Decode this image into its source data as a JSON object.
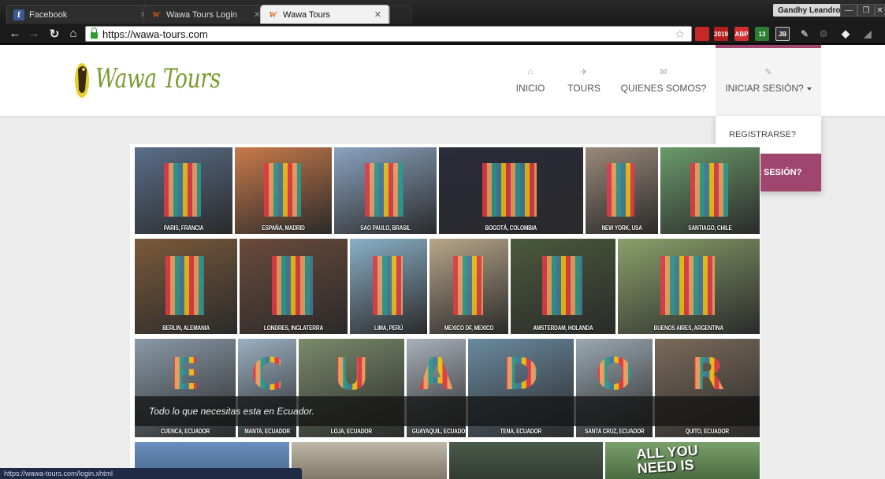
{
  "browser": {
    "tabs": [
      {
        "title": "Facebook",
        "favicon": "facebook-favicon"
      },
      {
        "title": "Wawa Tours Login",
        "favicon": "wawa-favicon"
      },
      {
        "title": "Wawa Tours",
        "favicon": "wawa-favicon",
        "active": true
      }
    ],
    "user": "Gandhy Leandro",
    "url": "https://wawa-tours.com",
    "status_url": "https://wawa-tours.com/login.xhtml",
    "extensions": [
      {
        "name": "noscript-icon",
        "color": "#c62828",
        "label": ""
      },
      {
        "name": "gmail-icon",
        "color": "#b71c1c",
        "label": "2019"
      },
      {
        "name": "adblock-icon",
        "color": "#d32f2f",
        "label": "ABP"
      },
      {
        "name": "tab-counter-icon",
        "color": "#2e7d32",
        "label": "13"
      },
      {
        "name": "jb-icon",
        "color": "#333333",
        "label": "JB"
      }
    ]
  },
  "site": {
    "logo_text": "Wawa Tours",
    "nav": [
      {
        "label": "INICIO",
        "icon": "home-icon"
      },
      {
        "label": "TOURS",
        "icon": "plane-icon"
      },
      {
        "label": "QUIENES SOMOS?",
        "icon": "envelope-icon"
      },
      {
        "label": "INICIAR SESIÓN?",
        "icon": "paperclip-icon",
        "open": true
      }
    ],
    "dropdown": [
      {
        "label": "REGISTRARSE?"
      },
      {
        "label": "INICIAR SESIÓN?",
        "active": true
      }
    ],
    "accent": "#a0456d",
    "banner_caption": "Todo lo que necesitas esta en Ecuador.",
    "banner_rows": [
      [
        "PARIS, FRANCIA",
        "ESPAÑA, MADRID",
        "SAO PAULO, BRASIL",
        "BOGOTÁ, COLOMBIA",
        "NEW YORK, USA",
        "SANTIAGO, CHILE"
      ],
      [
        "BERLIN, ALEMANIA",
        "LONDRES, INGLATERRA",
        "LIMA, PERÚ",
        "MEXICO DF, MEXICO",
        "AMSTERDAM, HOLANDA",
        "BUENOS AIRES, ARGENTINA"
      ],
      [
        "CUENCA, ECUADOR",
        "MANTA, ECUADOR",
        "LOJA, ECUADOR",
        "GUAYAQUIL, ECUADOR",
        "TENA, ECUADOR",
        "SANTA CRUZ, ECUADOR",
        "QUITO, ECUADOR"
      ]
    ],
    "banner_letters": [
      [
        "",
        "",
        "",
        "",
        "",
        ""
      ],
      [
        "",
        "",
        "",
        "",
        "",
        ""
      ],
      [
        "E",
        "C",
        "U",
        "A",
        "D",
        "O",
        "R"
      ]
    ],
    "promo_text": "ALL YOU NEED IS"
  }
}
